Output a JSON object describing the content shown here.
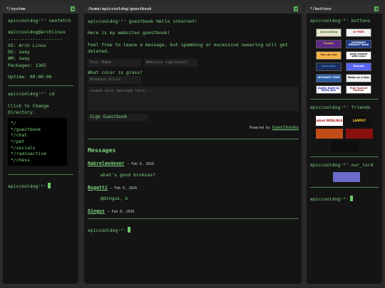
{
  "left": {
    "title": "*/system",
    "prompt1": "epiccooldog⁽ᴼ⁾ neofetch",
    "host": "epiccooldog@archlinux",
    "dashes": "--------------------",
    "os": "OS: Arch Linux",
    "de": "DE: sway",
    "wm": "WM: sway",
    "packages": "Packages: 1365",
    "uptime": "Uptime: 00:00:06",
    "prompt2": "epiccooldog⁽ᴼ⁾ cd",
    "click_line1": "Click to Change",
    "click_line2": "Directory:",
    "dirs": [
      "*/",
      "*/guestbook",
      "*/chat",
      "*/pet",
      "*/socials",
      "*/radioactive",
      "*/chess"
    ],
    "prompt3": "epiccooldog⁽ᴼ⁾"
  },
  "middle": {
    "title": "/home/epiccooldog/guestbook",
    "prompt1": "epiccooldog⁽ᴼ⁾ guestbook Hello internet!",
    "intro": "Here is my websites guestbook!",
    "warn1": "Feel free to leave a message, but spamming or excessive swearing will get",
    "warn2": "deleted.",
    "name_placeholder": "Your Name",
    "website_placeholder": "Website (optional)",
    "question": "What color is grass?",
    "answer_placeholder": "Windows bliss",
    "message_placeholder": "Leave your message here...",
    "sign_button": "Sign Guestbook",
    "powered_by": "Powered by",
    "powered_link": "Guestbooks",
    "messages_heading": "Messages",
    "entries": [
      {
        "author": "Nakrelen4ever",
        "date": "– Feb 9, 2026",
        "text": "what's good bromies?"
      },
      {
        "author": "Bugatti",
        "date": "– Feb 9, 2026",
        "text": "@dingus, k"
      },
      {
        "author": "Dingus",
        "date": "– Feb 8, 2026",
        "text": ""
      }
    ],
    "prompt2": "epiccooldog⁽ᴼ⁾"
  },
  "right": {
    "title": "*/buttons",
    "prompt_buttons": "epiccooldog⁽ᴼ⁾ buttons",
    "buttons": [
      {
        "label": "epiccooldog",
        "bg": "#e8e3c7",
        "fg": "#3b6f3b"
      },
      {
        "label": "AI-FREE",
        "bg": "#f2f2f2",
        "fg": "#c41f1f"
      },
      {
        "label": "Firefox",
        "bg": "#5a2a82",
        "fg": "#ffb14a"
      },
      {
        "label": "INTERNET PRIVACY NOW",
        "bg": "#1e3b8a",
        "fg": "#ffffff"
      },
      {
        "label": "You can too",
        "bg": "#f2b34a",
        "fg": "#5a2a00"
      },
      {
        "label": "best viewed with eyes",
        "bg": "#ffffff",
        "fg": "#1a1a1a"
      },
      {
        "label": "arch linux",
        "bg": "#1a2a5a",
        "fg": "#3aa0e0"
      },
      {
        "label": "Discord",
        "bg": "#5865f2",
        "fg": "#ffffff"
      },
      {
        "label": "INTERNET FREE",
        "bg": "#2a5fa8",
        "fg": "#ffffff"
      },
      {
        "label": "Made on a Mac",
        "bg": "#f0f0f0",
        "fg": "#222222"
      },
      {
        "label": "eighty eight by thirty one",
        "bg": "#f5f5ff",
        "fg": "#2020a0"
      },
      {
        "label": "Free Speech Forever",
        "bg": "#ffffff",
        "fg": "#8a1a1a"
      }
    ],
    "prompt_friends": "epiccooldog⁽ᴼ⁾ friends",
    "friends": [
      {
        "label": "Jehad INDELIBLE",
        "bg": "#ffffff",
        "fg": "#b01515"
      },
      {
        "label": "LAMPUT",
        "bg": "#111111",
        "fg": "#ffcc33"
      },
      {
        "label": "",
        "bg": "#c24b1a",
        "fg": "#ffffff"
      },
      {
        "label": "",
        "bg": "#8a0f0f",
        "fg": "#ffffff"
      },
      {
        "label": "",
        "bg": "#0d0d0d",
        "fg": "#7ed37e"
      }
    ],
    "prompt_lord": "epiccooldog⁽ᴼ⁾ our_lord",
    "lord": {
      "label": "",
      "bg": "#6b6bc8",
      "fg": "#ffffff"
    },
    "prompt_end": "epiccooldog⁽ᴼ⁾"
  }
}
